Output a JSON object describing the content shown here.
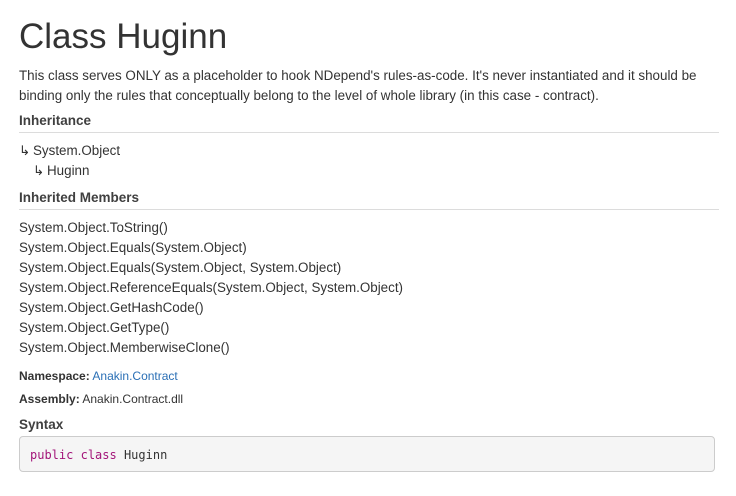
{
  "title": "Class Huginn",
  "summary": "This class serves ONLY as a placeholder to hook NDepend's rules-as-code. It's never instantiated and it should be binding only the rules that conceptually belong to the level of whole library (in this case - contract).",
  "inheritance": {
    "heading": "Inheritance",
    "arrow": "↳",
    "items": [
      "System.Object",
      "Huginn"
    ]
  },
  "inherited_members": {
    "heading": "Inherited Members",
    "items": [
      "System.Object.ToString()",
      "System.Object.Equals(System.Object)",
      "System.Object.Equals(System.Object, System.Object)",
      "System.Object.ReferenceEquals(System.Object, System.Object)",
      "System.Object.GetHashCode()",
      "System.Object.GetType()",
      "System.Object.MemberwiseClone()"
    ]
  },
  "namespace": {
    "label": "Namespace:",
    "value": "Anakin.Contract"
  },
  "assembly": {
    "label": "Assembly:",
    "value": "Anakin.Contract.dll"
  },
  "syntax": {
    "heading": "Syntax",
    "kw_public": "public",
    "kw_class": "class",
    "name": "Huginn"
  },
  "colors": {
    "link": "#2a6fb5",
    "keyword": "#a31579",
    "code_bg": "#f5f5f5"
  }
}
